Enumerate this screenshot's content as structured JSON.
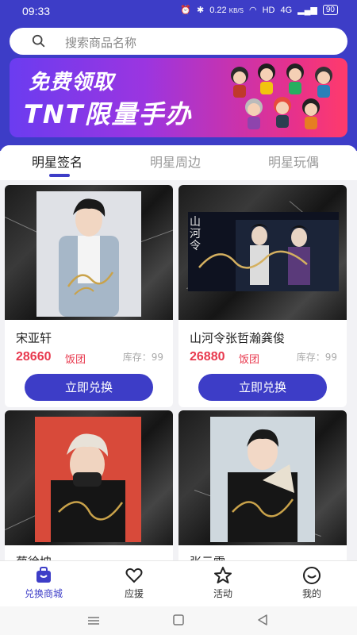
{
  "status": {
    "time": "09:33",
    "speed": "0.22",
    "speed_unit": "KB/S",
    "hd": "HD",
    "network": "4G",
    "battery": "90"
  },
  "search": {
    "placeholder": "搜索商品名称"
  },
  "banner": {
    "line1": "免费领取",
    "line2": "TNT限量手办"
  },
  "tabs": [
    "明星签名",
    "明星周边",
    "明星玩偶"
  ],
  "products": [
    {
      "name": "宋亚轩",
      "price": "28660",
      "unit": "饭团",
      "stock": "库存：99",
      "button": "立即兑换"
    },
    {
      "name": "山河令张哲瀚龚俊",
      "price": "26880",
      "unit": "饭团",
      "stock": "库存：99",
      "button": "立即兑换",
      "poster_title": "山河令"
    },
    {
      "name": "蔡徐坤"
    },
    {
      "name": "张云雷"
    }
  ],
  "nav": [
    {
      "label": "兑换商城",
      "icon": "bag-icon",
      "active": true
    },
    {
      "label": "应援",
      "icon": "heart-icon"
    },
    {
      "label": "活动",
      "icon": "star-icon"
    },
    {
      "label": "我的",
      "icon": "smile-icon"
    }
  ],
  "colors": {
    "primary": "#3d3dc7",
    "price": "#e8394e"
  }
}
